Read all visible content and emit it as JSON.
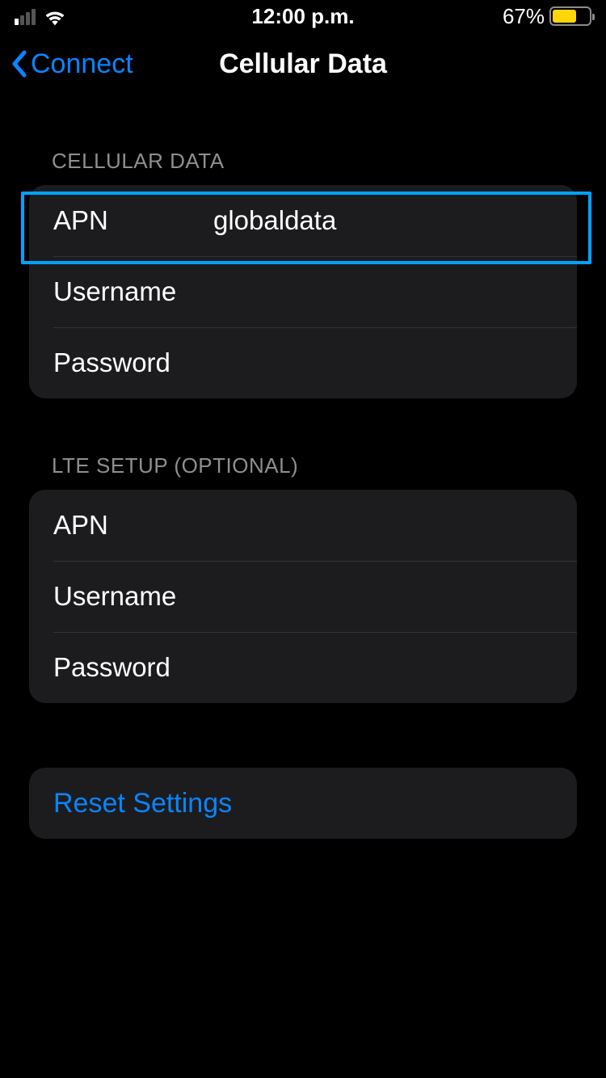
{
  "status": {
    "time": "12:00 p.m.",
    "battery_percent": "67%"
  },
  "nav": {
    "back_label": "Connect",
    "title": "Cellular Data"
  },
  "sections": {
    "cellular": {
      "header": "CELLULAR DATA",
      "rows": {
        "apn": {
          "label": "APN",
          "value": "globaldata"
        },
        "username": {
          "label": "Username",
          "value": ""
        },
        "password": {
          "label": "Password",
          "value": ""
        }
      }
    },
    "lte": {
      "header": "LTE SETUP (OPTIONAL)",
      "rows": {
        "apn": {
          "label": "APN",
          "value": ""
        },
        "username": {
          "label": "Username",
          "value": ""
        },
        "password": {
          "label": "Password",
          "value": ""
        }
      }
    }
  },
  "reset": {
    "label": "Reset Settings"
  },
  "colors": {
    "accent": "#0a84ff",
    "highlight": "#00a3ff",
    "battery_fill": "#ffd60a"
  }
}
